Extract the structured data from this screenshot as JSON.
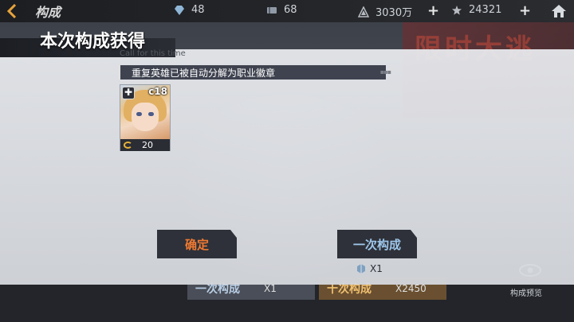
{
  "topbar": {
    "title": "构成",
    "resources": [
      {
        "icon": "diamond-icon",
        "value": "48"
      },
      {
        "icon": "ticket-icon",
        "value": "68"
      },
      {
        "icon": "gold-icon",
        "value": "3030万"
      },
      {
        "icon": "star-crystal-icon",
        "value": "24321"
      }
    ]
  },
  "background": {
    "banner_text": "限时大逃",
    "bottom_buttons": [
      {
        "label": "一次构成",
        "cost": "X1"
      },
      {
        "label": "十次构成",
        "cost": "X2450"
      }
    ],
    "preview_label": "构成预览"
  },
  "dialog": {
    "title": "本次构成获得",
    "subtitle": "Call for this time",
    "notice": "重复英雄已被自动分解为职业徽章",
    "reward": {
      "code": "c18",
      "amount": "20"
    },
    "confirm_label": "确定",
    "once_label": "一次构成",
    "once_cost": "X1"
  },
  "colors": {
    "accent_orange": "#f07a32",
    "accent_blue": "#9ec6ea",
    "coin": "#e6b23a"
  }
}
